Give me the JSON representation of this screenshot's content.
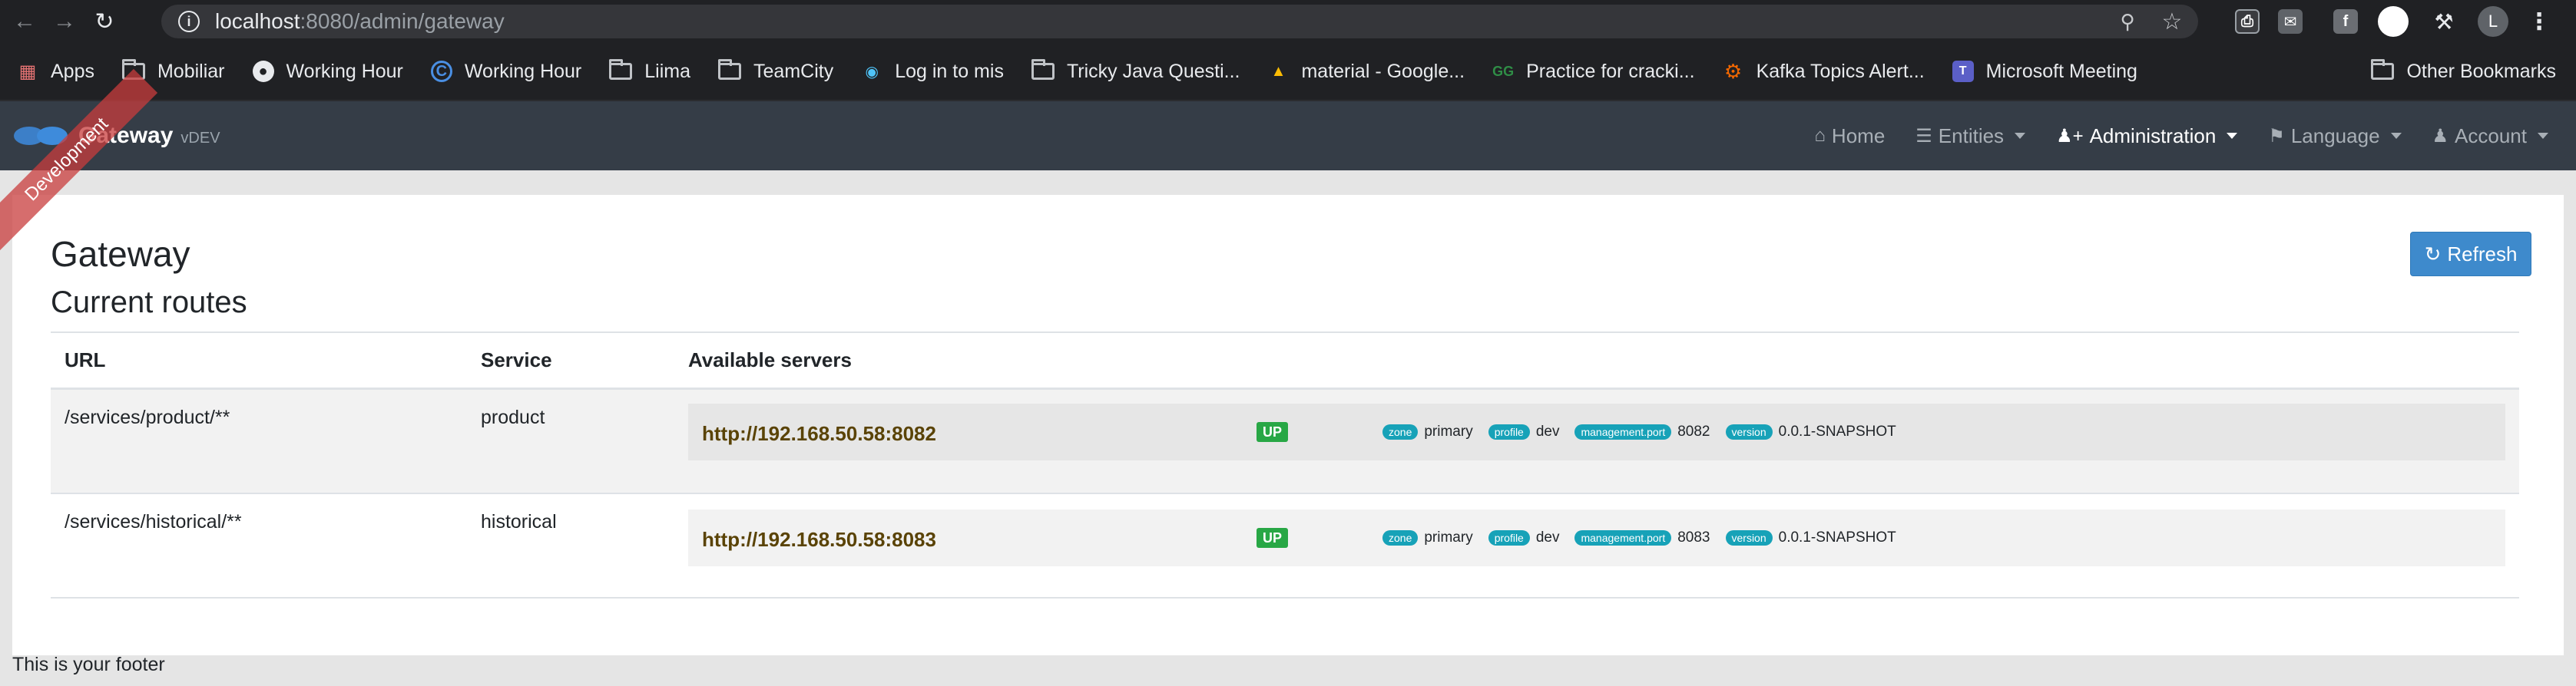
{
  "browser": {
    "url_host": "localhost",
    "url_path": ":8080/admin/gateway",
    "profile_letter": "L"
  },
  "bookmarks": [
    {
      "label": "Apps",
      "icon": "apps-grid-icon"
    },
    {
      "label": "Mobiliar",
      "icon": "folder-icon"
    },
    {
      "label": "Working Hour",
      "icon": "globe-icon"
    },
    {
      "label": "Working Hour",
      "icon": "site-icon"
    },
    {
      "label": "Liima",
      "icon": "folder-icon"
    },
    {
      "label": "TeamCity",
      "icon": "folder-icon"
    },
    {
      "label": "Log in to mis",
      "icon": "eye-icon"
    },
    {
      "label": "Tricky Java Questi...",
      "icon": "folder-icon"
    },
    {
      "label": "material - Google...",
      "icon": "drive-icon"
    },
    {
      "label": "Practice for cracki...",
      "icon": "gfg-icon"
    },
    {
      "label": "Kafka Topics Alert...",
      "icon": "grafana-icon"
    },
    {
      "label": "Microsoft Meeting",
      "icon": "teams-icon"
    }
  ],
  "other_bookmarks": "Other Bookmarks",
  "app": {
    "brand": "Gateway",
    "version": "vDEV",
    "ribbon": "Development",
    "nav": [
      {
        "label": "Home",
        "icon": "home-icon",
        "caret": false,
        "active": false
      },
      {
        "label": "Entities",
        "icon": "list-icon",
        "caret": true,
        "active": false
      },
      {
        "label": "Administration",
        "icon": "user-plus-icon",
        "caret": true,
        "active": true
      },
      {
        "label": "Language",
        "icon": "flag-icon",
        "caret": true,
        "active": false
      },
      {
        "label": "Account",
        "icon": "user-icon",
        "caret": true,
        "active": false
      }
    ]
  },
  "page": {
    "title": "Gateway",
    "subtitle": "Current routes",
    "refresh_label": "Refresh"
  },
  "table": {
    "headers": {
      "url": "URL",
      "service": "Service",
      "servers": "Available servers"
    },
    "rows": [
      {
        "url": "/services/product/**",
        "service": "product",
        "server": "http://192.168.50.58:8082",
        "status": "UP",
        "zone_label": "zone",
        "zone": "primary",
        "profile_label": "profile",
        "profile": "dev",
        "mport_label": "management.port",
        "mport": "8082",
        "version_label": "version",
        "version": "0.0.1-SNAPSHOT"
      },
      {
        "url": "/services/historical/**",
        "service": "historical",
        "server": "http://192.168.50.58:8083",
        "status": "UP",
        "zone_label": "zone",
        "zone": "primary",
        "profile_label": "profile",
        "profile": "dev",
        "mport_label": "management.port",
        "mport": "8083",
        "version_label": "version",
        "version": "0.0.1-SNAPSHOT"
      }
    ]
  },
  "footer": "This is your footer"
}
